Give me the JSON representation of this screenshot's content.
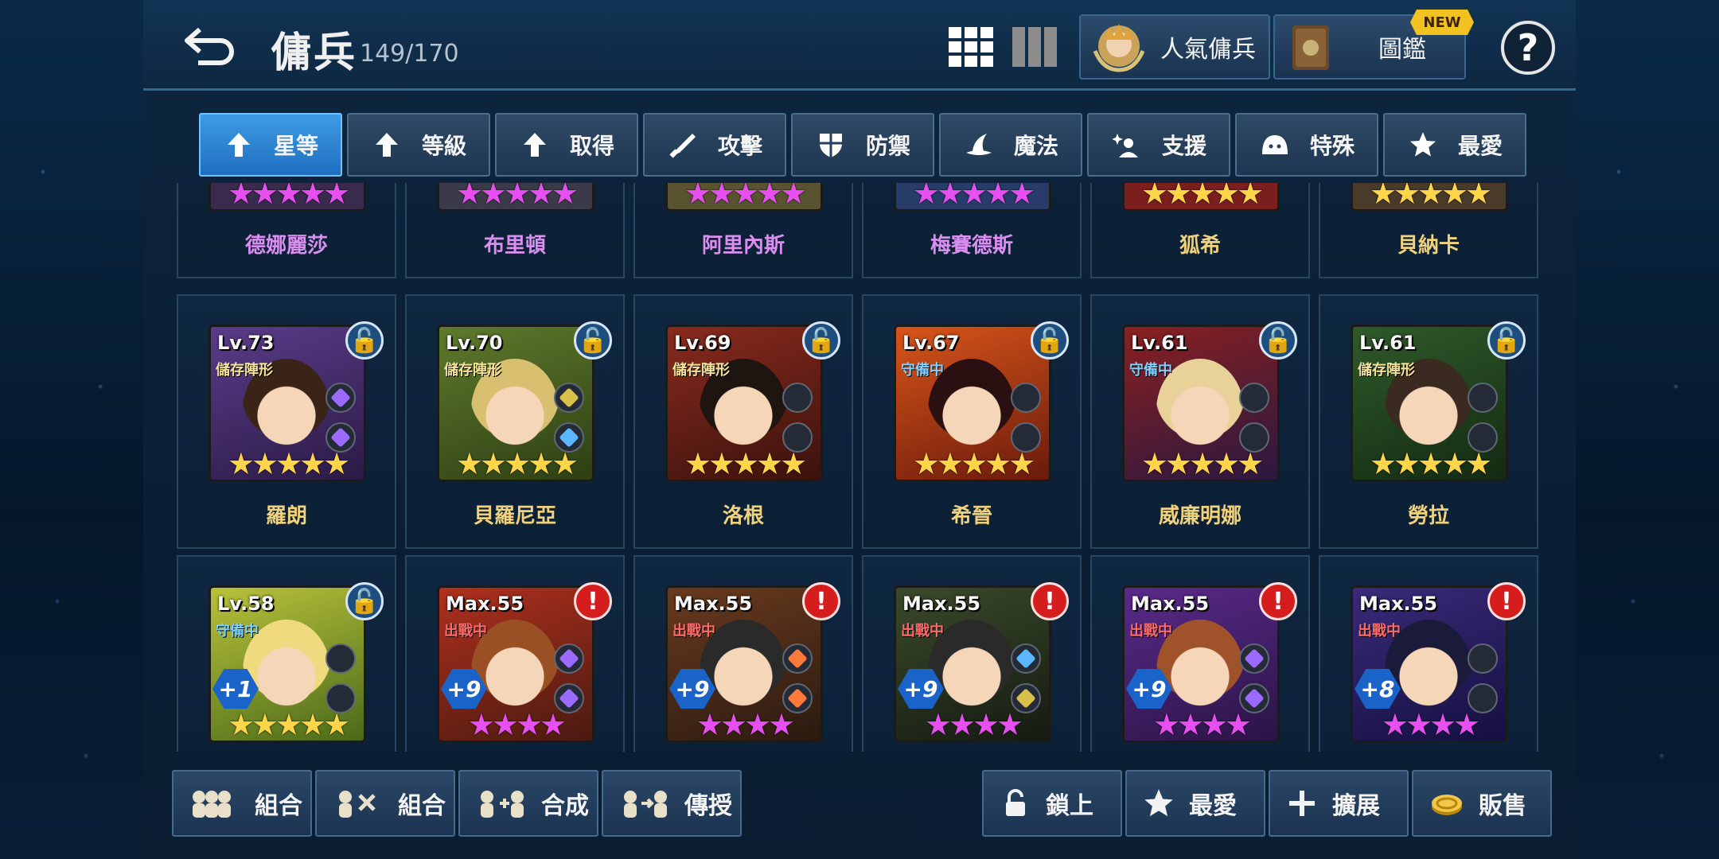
{
  "header": {
    "title": "傭兵",
    "count": "149/170",
    "popular_label": "人氣傭兵",
    "codex_label": "圖鑑",
    "codex_badge": "NEW",
    "help": "?"
  },
  "tabs": [
    {
      "label": "星等",
      "icon": "arrow-up-icon",
      "active": true
    },
    {
      "label": "等級",
      "icon": "arrow-up-icon",
      "active": false
    },
    {
      "label": "取得",
      "icon": "arrow-up-icon",
      "active": false
    },
    {
      "label": "攻擊",
      "icon": "sword-icon",
      "active": false
    },
    {
      "label": "防禦",
      "icon": "shield-icon",
      "active": false
    },
    {
      "label": "魔法",
      "icon": "witch-hat-icon",
      "active": false
    },
    {
      "label": "支援",
      "icon": "sparkle-person-icon",
      "active": false
    },
    {
      "label": "特殊",
      "icon": "slime-icon",
      "active": false
    },
    {
      "label": "最愛",
      "icon": "star-icon",
      "active": false
    }
  ],
  "top_row_names": [
    "德娜麗莎",
    "布里頓",
    "阿里內斯",
    "梅賽德斯",
    "狐希",
    "貝納卡"
  ],
  "heroes_row2": [
    {
      "name": "羅朗",
      "level": "Lv.73",
      "status": "儲存陣形",
      "stars": "★★★★★"
    },
    {
      "name": "貝羅尼亞",
      "level": "Lv.70",
      "status": "儲存陣形",
      "stars": "★★★★★"
    },
    {
      "name": "洛根",
      "level": "Lv.69",
      "status": "儲存陣形",
      "stars": "★★★★★"
    },
    {
      "name": "希晉",
      "level": "Lv.67",
      "status": "守備中",
      "stars": "★★★★★"
    },
    {
      "name": "威廉明娜",
      "level": "Lv.61",
      "status": "守備中",
      "stars": "★★★★★"
    },
    {
      "name": "勞拉",
      "level": "Lv.61",
      "status": "儲存陣形",
      "stars": "★★★★★"
    }
  ],
  "heroes_row3": [
    {
      "level": "Lv.58",
      "status": "守備中",
      "plus": "+1",
      "stars": "★★★★★"
    },
    {
      "level": "Max.55",
      "status": "出戰中",
      "plus": "+9",
      "stars": "★★★★"
    },
    {
      "level": "Max.55",
      "status": "出戰中",
      "plus": "+9",
      "stars": "★★★★"
    },
    {
      "level": "Max.55",
      "status": "出戰中",
      "plus": "+9",
      "stars": "★★★★"
    },
    {
      "level": "Max.55",
      "status": "出戰中",
      "plus": "+9",
      "stars": "★★★★"
    },
    {
      "level": "Max.55",
      "status": "出戰中",
      "plus": "+8",
      "stars": "★★★★"
    }
  ],
  "bottom_left": [
    "組合",
    "組合",
    "合成",
    "傳授"
  ],
  "bottom_right": [
    "鎖上",
    "最愛",
    "擴展",
    "販售"
  ],
  "colors": {
    "accent": "#2f86d6",
    "gold": "#ffd54a",
    "purple_star": "#e84ff0"
  }
}
